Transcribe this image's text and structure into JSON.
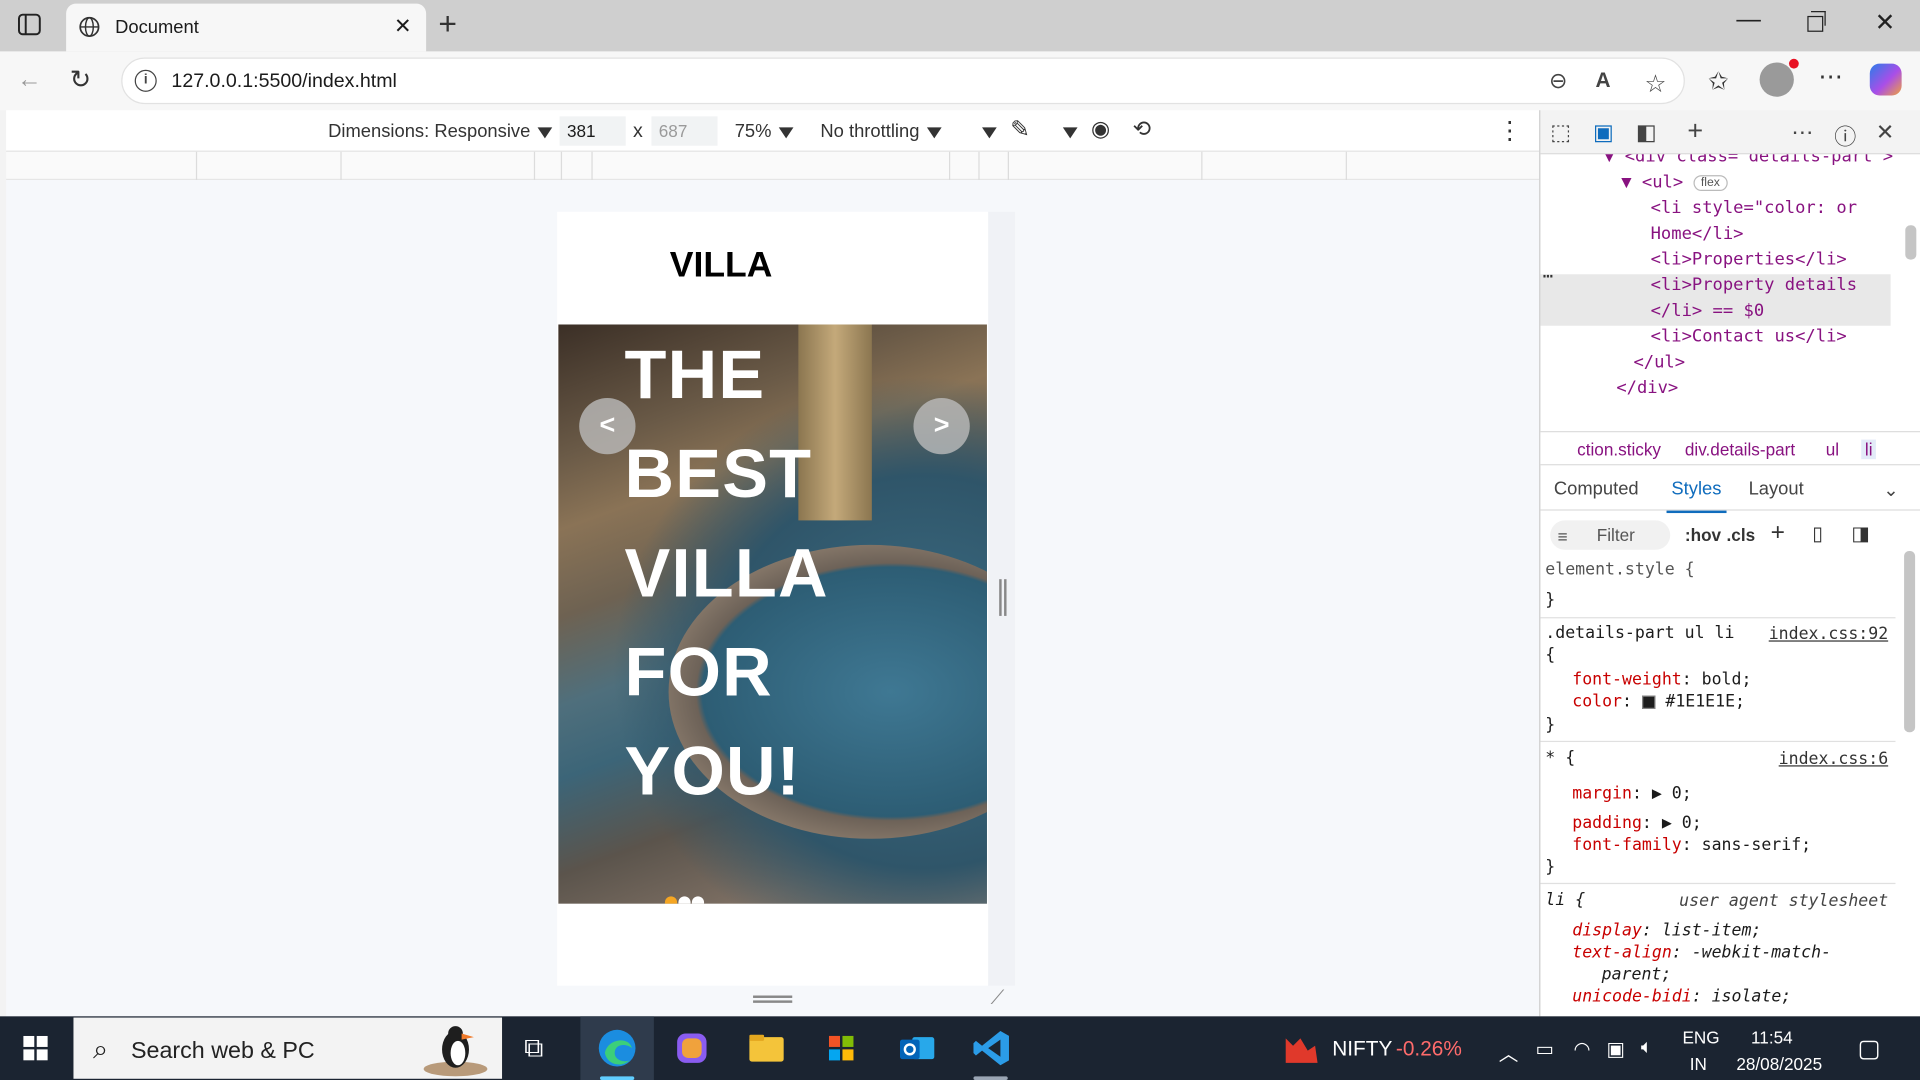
{
  "browser": {
    "tab_title": "Document",
    "url": "127.0.0.1:5500/index.html"
  },
  "device_toolbar": {
    "dimensions_label": "Dimensions: Responsive",
    "width": "381",
    "times": "x",
    "height": "687",
    "zoom": "75%",
    "throttling": "No throttling"
  },
  "page": {
    "logo": "VILLA",
    "hero_lines": [
      "THE",
      "BEST",
      "VILLA",
      "FOR",
      "YOU!"
    ],
    "prev_arrow": "<",
    "next_arrow": ">",
    "slides": 3,
    "active_slide": 1
  },
  "devtools": {
    "dom_lines": [
      {
        "indent": 0,
        "text": "<div class= details-part >"
      },
      {
        "indent": 1,
        "tag": "<ul>",
        "badge": "flex"
      },
      {
        "indent": 2,
        "text": "<li style=\"color: or"
      },
      {
        "indent": 2,
        "text": "Home</li>"
      },
      {
        "indent": 2,
        "text": "<li>Properties</li>"
      },
      {
        "indent": 2,
        "text": "<li>Property details"
      },
      {
        "indent": 2,
        "text": "</li> == $0"
      },
      {
        "indent": 2,
        "text": "<li>Contact us</li>"
      },
      {
        "indent": 1,
        "text": "</ul>"
      },
      {
        "indent": 0,
        "text": "</div>"
      }
    ],
    "breadcrumbs": [
      "ction.sticky",
      "div.details-part",
      "ul",
      "li"
    ],
    "tabs": [
      "Computed",
      "Styles",
      "Layout"
    ],
    "active_tab": "Styles",
    "filter_placeholder": "Filter",
    "hov": ":hov",
    "cls": ".cls",
    "styles": {
      "element_style": "element.style {",
      "close_brace": "}",
      "rule1_selector": ".details-part ul li",
      "rule1_source": "index.css:92",
      "rule1_open": "{",
      "rule1_p1_name": "font-weight",
      "rule1_p1_value": "bold;",
      "rule1_p2_name": "color",
      "rule1_p2_value": "#1E1E1E;",
      "rule2_selector": "* {",
      "rule2_source": "index.css:6",
      "rule2_p1_name": "margin",
      "rule2_p1_value": "0;",
      "rule2_p2_name": "padding",
      "rule2_p2_value": "0;",
      "rule2_p3_name": "font-family",
      "rule2_p3_value": "sans-serif;",
      "rule3_selector": "li {",
      "rule3_source": "user agent stylesheet",
      "rule3_p1_name": "display",
      "rule3_p1_value": "list-item;",
      "rule3_p2_name": "text-align",
      "rule3_p2_value": "-webkit-match-",
      "rule3_p2_value_cont": "parent;",
      "rule3_p3_name": "unicode-bidi",
      "rule3_p3_value": "isolate;"
    }
  },
  "taskbar": {
    "search_text": "Search web & PC",
    "stock_name": "NIFTY",
    "stock_change": "-0.26%",
    "lang1": "ENG",
    "lang2": "IN",
    "time": "11:54",
    "date": "28/08/2025",
    "colors": {
      "accent": "#60cdff",
      "stock_down": "#ff6b6b"
    }
  }
}
